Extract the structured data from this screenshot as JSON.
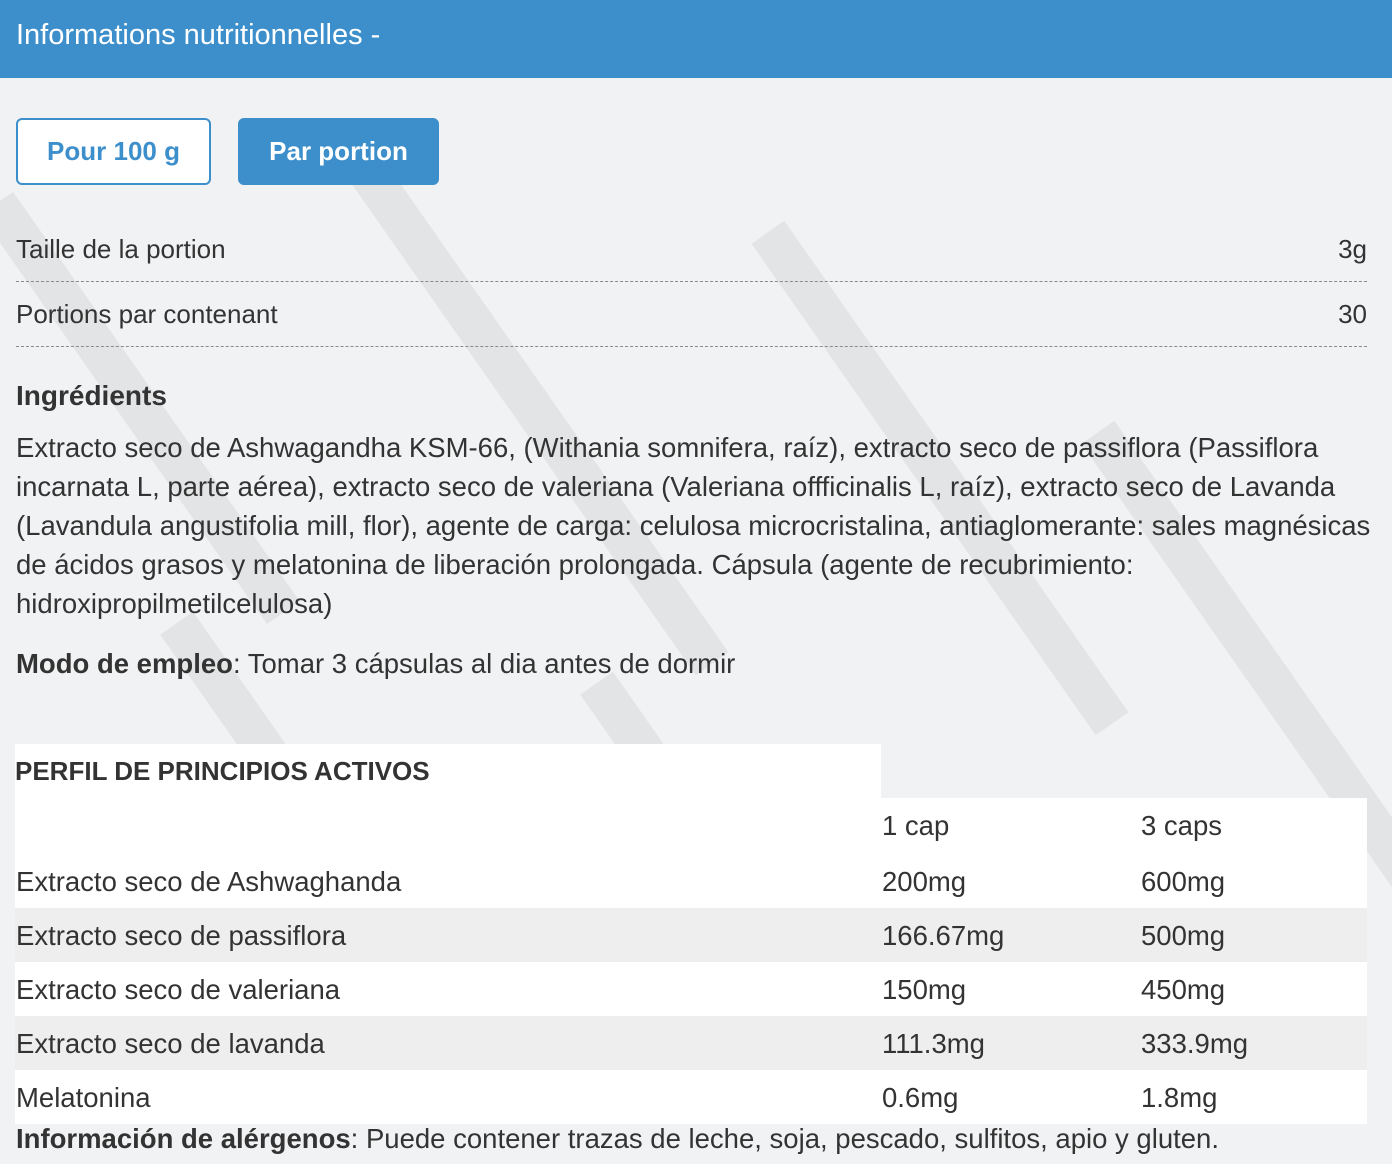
{
  "header": {
    "title": "Informations nutritionnelles -"
  },
  "tabs": [
    {
      "label": "Pour 100 g",
      "active": false
    },
    {
      "label": "Par portion",
      "active": true
    }
  ],
  "serving": {
    "size_label": "Taille de la portion",
    "size_value": "3g",
    "count_label": "Portions par contenant",
    "count_value": "30"
  },
  "ingredients": {
    "title": "Ingrédients",
    "text": "Extracto seco de Ashwagandha KSM-66, (Withania somnifera, raíz), extracto seco de passiflora (Passiflora incarnata L, parte aérea), extracto seco de valeriana (Valeriana offficinalis L, raíz), extracto seco de Lavanda (Lavandula angustifolia mill, flor), agente de carga: celulosa microcristalina, antiaglomerante: sales magnésicas de ácidos grasos y melatonina de liberación prolongada. Cápsula (agente de recubrimiento: hidroxipropilmetilcelulosa)"
  },
  "usage": {
    "label": "Modo de empleo",
    "text": ": Tomar 3 cápsulas al dia antes de dormir"
  },
  "active_table": {
    "title": "PERFIL DE PRINCIPIOS ACTIVOS",
    "columns": [
      "",
      "1 cap",
      "3 caps"
    ],
    "rows": [
      {
        "name": "Extracto seco de Ashwaghanda",
        "one": "200mg",
        "three": "600mg"
      },
      {
        "name": "Extracto seco de passiflora",
        "one": "166.67mg",
        "three": "500mg"
      },
      {
        "name": "Extracto seco de valeriana",
        "one": "150mg",
        "three": "450mg"
      },
      {
        "name": "Extracto seco de lavanda",
        "one": "111.3mg",
        "three": "333.9mg"
      },
      {
        "name": "Melatonina",
        "one": "0.6mg",
        "three": "1.8mg"
      }
    ]
  },
  "allergens": {
    "label": "Información de alérgenos",
    "text": ": Puede contener trazas de leche, soja, pescado, sulfitos, apio y gluten."
  },
  "colors": {
    "accent": "#3d8fcb",
    "background": "#f1f2f3",
    "text": "#333333"
  }
}
